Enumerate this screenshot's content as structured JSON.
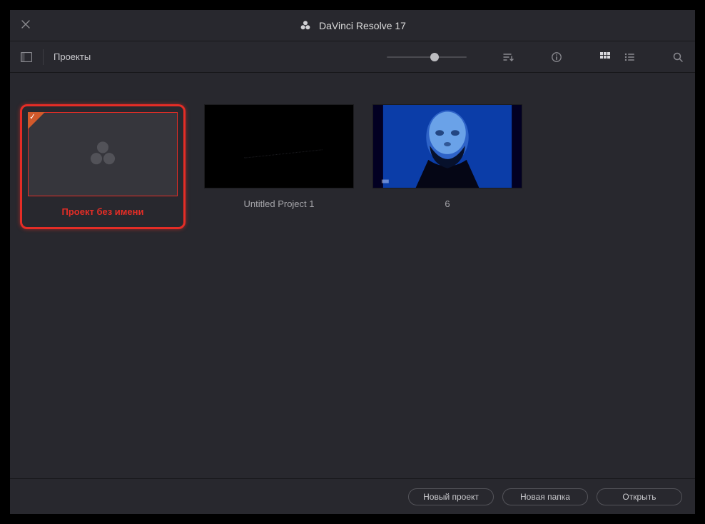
{
  "app": {
    "title": "DaVinci Resolve 17"
  },
  "toolbar": {
    "breadcrumb": "Проекты"
  },
  "projects": [
    {
      "name": "Проект без имени"
    },
    {
      "name": "Untitled Project 1"
    },
    {
      "name": "6"
    }
  ],
  "footer": {
    "new_project": "Новый проект",
    "new_folder": "Новая папка",
    "open": "Открыть"
  }
}
